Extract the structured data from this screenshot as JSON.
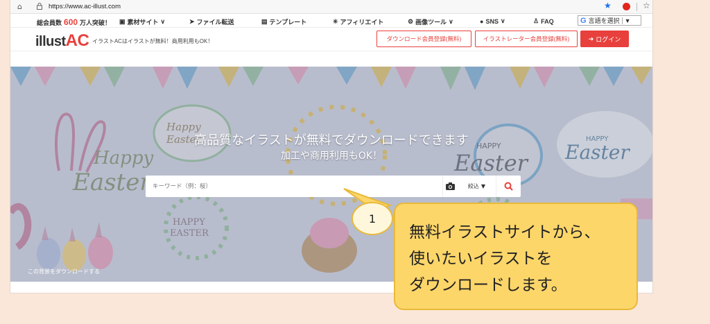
{
  "browser": {
    "url": "https://www.ac-illust.com"
  },
  "topnav": {
    "members_prefix": "総会員数",
    "members_count": "600",
    "members_suffix": "万人突破！",
    "items": [
      "素材サイト",
      "ファイル転送",
      "テンプレート",
      "アフィリエイト",
      "画像ツール",
      "SNS",
      "FAQ"
    ],
    "language": "言語を選択"
  },
  "header": {
    "logo_main": "illust",
    "logo_accent": "AC",
    "tagline": "イラストACはイラストが無料！商用利用もOK！",
    "download_register": "ダウンロード会員登録(無料)",
    "illustrator_register": "イラストレーター会員登録(無料)",
    "login": "ログイン"
  },
  "hero": {
    "title": "高品質なイラストが無料でダウンロードできます",
    "subtitle": "加工や商用利用もOK！",
    "search_placeholder": "キーワード（例：桜）",
    "filter_label": "絞込",
    "download_background": "この背景をダウンロードする",
    "scene_text": [
      "Happy",
      "Easter",
      "Happy",
      "Easter",
      "HAPPY",
      "Easter",
      "HAPPY",
      "Easter",
      "HAPPY",
      "EASTER"
    ]
  },
  "annotation": {
    "step_number": "1",
    "lines": [
      "無料イラストサイトから、",
      "使いたいイラストを",
      "ダウンロードします。"
    ]
  },
  "colors": {
    "brand_red": "#e8403c",
    "callout_fill": "#fdd66a",
    "callout_border": "#e8b93a",
    "page_bg": "#fbe7d9"
  }
}
